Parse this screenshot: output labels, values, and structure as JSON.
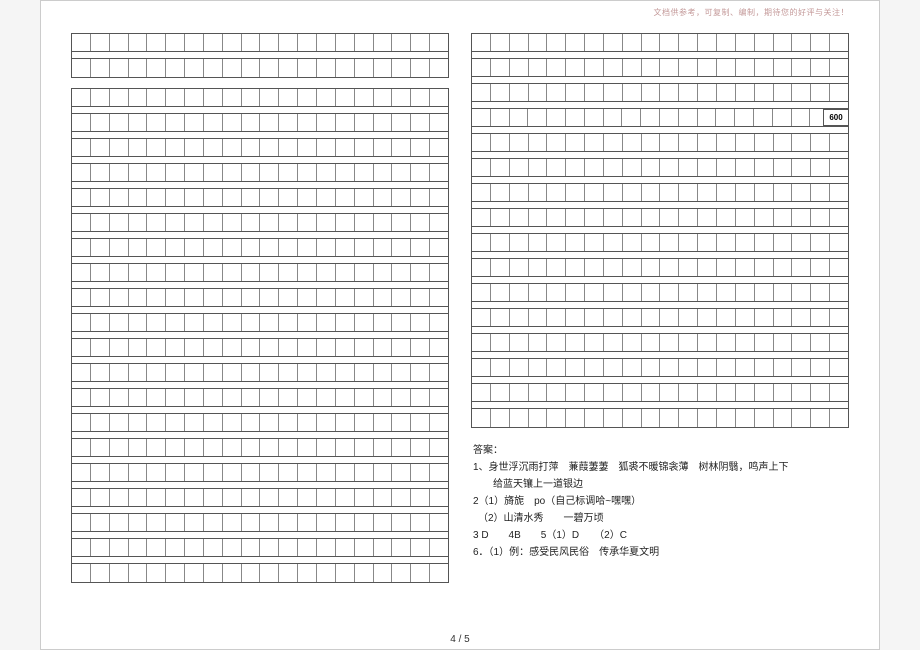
{
  "header_note": "文档供参考，可复制、编制，期待您的好评与关注！",
  "grid": {
    "cells_per_row": 20,
    "left_column": {
      "blocks": [
        {
          "rows": 2,
          "with_spacers": true
        },
        {
          "rows": 20,
          "with_spacers": true
        }
      ]
    },
    "right_column": {
      "blocks": [
        {
          "rows": 16,
          "with_spacers": true,
          "badge_row_index": 3,
          "badge": "600"
        }
      ]
    }
  },
  "answers": {
    "title": "答案：",
    "lines": [
      "1、身世浮沉雨打萍　蒹葭萋萋　狐裘不暖锦衾薄　树林阴翳，鸣声上下",
      "　　给蓝天镶上一道银边",
      "2（1）旖旎　po（自己标调哈~嘿嘿）",
      "　（2）山清水秀　　一碧万顷",
      "3 D　　4B　　5（1）D　　（2）C",
      "6．（1）例：感受民风民俗　传承华夏文明"
    ]
  },
  "page_number": "4 / 5"
}
